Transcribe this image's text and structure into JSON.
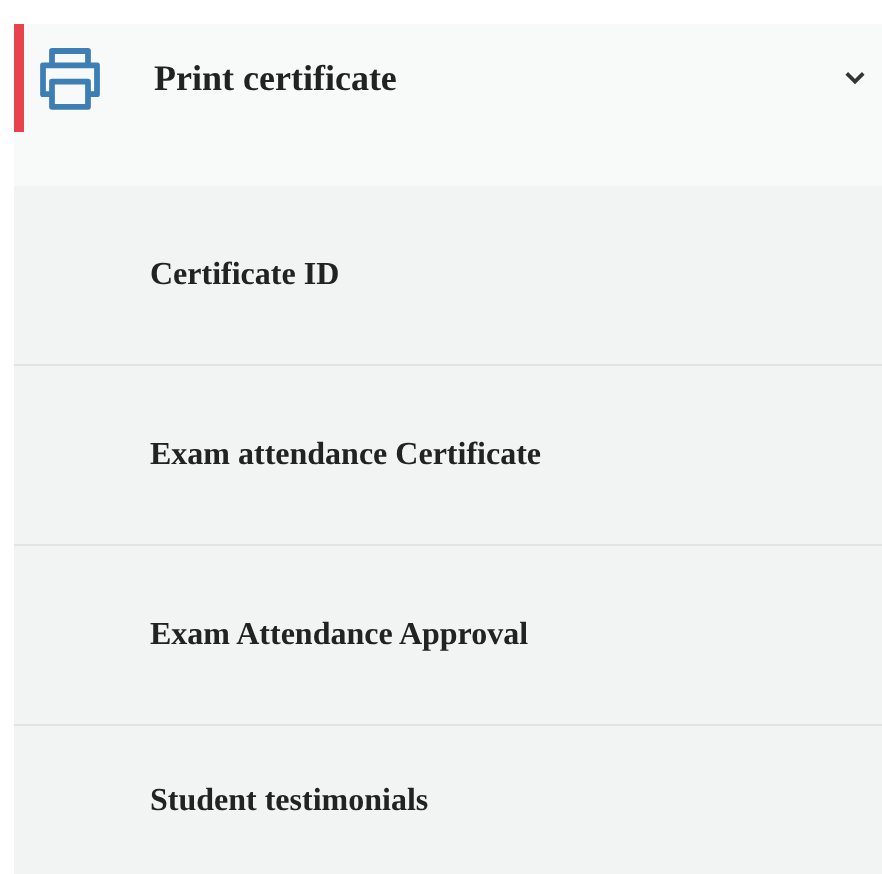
{
  "menu": {
    "label": "Print certificate",
    "selected": true,
    "expanded": true,
    "children": [
      {
        "label": "Certificate ID"
      },
      {
        "label": "Exam attendance Certificate"
      },
      {
        "label": "Exam Attendance Approval"
      },
      {
        "label": "Student testimonials"
      }
    ]
  }
}
